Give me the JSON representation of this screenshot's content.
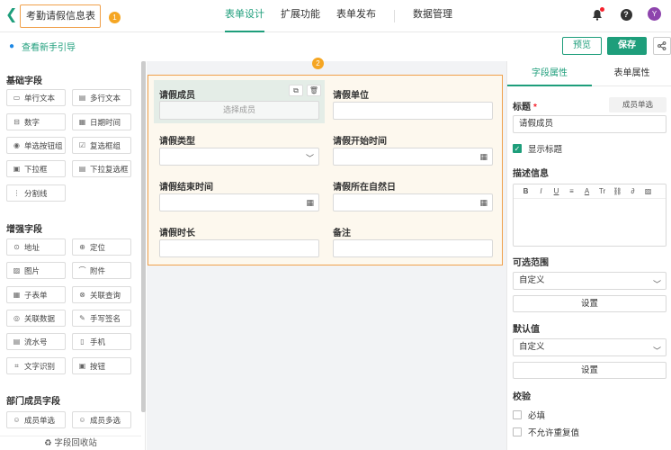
{
  "header": {
    "title": "考勤请假信息表",
    "badge1": "1",
    "tabs": [
      "表单设计",
      "扩展功能",
      "表单发布",
      "数据管理"
    ],
    "avatar": "Y"
  },
  "toolbar": {
    "guide": "查看新手引导",
    "preview": "预览",
    "save": "保存"
  },
  "left": {
    "basic_title": "基础字段",
    "basic_items": [
      {
        "label": "单行文本",
        "icon": "single-line-icon"
      },
      {
        "label": "多行文本",
        "icon": "multi-line-icon"
      },
      {
        "label": "数字",
        "icon": "number-icon"
      },
      {
        "label": "日期时间",
        "icon": "calendar-icon"
      },
      {
        "label": "单选按钮组",
        "icon": "radio-icon"
      },
      {
        "label": "复选框组",
        "icon": "checkbox-icon"
      },
      {
        "label": "下拉框",
        "icon": "dropdown-icon"
      },
      {
        "label": "下拉复选框",
        "icon": "dropdown-multi-icon"
      },
      {
        "label": "分割线",
        "icon": "divider-icon"
      }
    ],
    "adv_title": "增强字段",
    "adv_items": [
      {
        "label": "地址",
        "icon": "location-icon"
      },
      {
        "label": "定位",
        "icon": "target-icon"
      },
      {
        "label": "图片",
        "icon": "image-icon"
      },
      {
        "label": "附件",
        "icon": "attachment-icon"
      },
      {
        "label": "子表单",
        "icon": "subform-icon"
      },
      {
        "label": "关联查询",
        "icon": "link-query-icon"
      },
      {
        "label": "关联数据",
        "icon": "link-data-icon"
      },
      {
        "label": "手写签名",
        "icon": "signature-icon"
      },
      {
        "label": "流水号",
        "icon": "serial-icon"
      },
      {
        "label": "手机",
        "icon": "phone-icon"
      },
      {
        "label": "文字识别",
        "icon": "ocr-icon"
      },
      {
        "label": "按钮",
        "icon": "button-icon"
      }
    ],
    "dept_title": "部门成员字段",
    "dept_items": [
      {
        "label": "成员单选",
        "icon": "member-icon"
      },
      {
        "label": "成员多选",
        "icon": "members-icon"
      }
    ],
    "recycle": "字段回收站"
  },
  "canvas": {
    "badge2": "2",
    "fields": {
      "member": {
        "label": "请假成员",
        "placeholder": "选择成员"
      },
      "unit": {
        "label": "请假单位"
      },
      "type": {
        "label": "请假类型"
      },
      "start": {
        "label": "请假开始时间"
      },
      "end": {
        "label": "请假结束时间"
      },
      "location": {
        "label": "请假所在自然日"
      },
      "duration": {
        "label": "请假时长"
      },
      "remark": {
        "label": "备注"
      }
    }
  },
  "right": {
    "tabs": [
      "字段属性",
      "表单属性"
    ],
    "title_label": "标题",
    "title_req": "*",
    "field_type": "成员单选",
    "title_value": "请假成员",
    "show_title": "显示标题",
    "desc_label": "描述信息",
    "range_label": "可选范围",
    "range_value": "自定义",
    "set_btn": "设置",
    "default_label": "默认值",
    "default_value": "自定义",
    "check_label": "校验",
    "required": "必填",
    "no_dup": "不允许重复值"
  },
  "colors": {
    "accent": "#1e9e7b",
    "highlight": "#f0a04b"
  }
}
